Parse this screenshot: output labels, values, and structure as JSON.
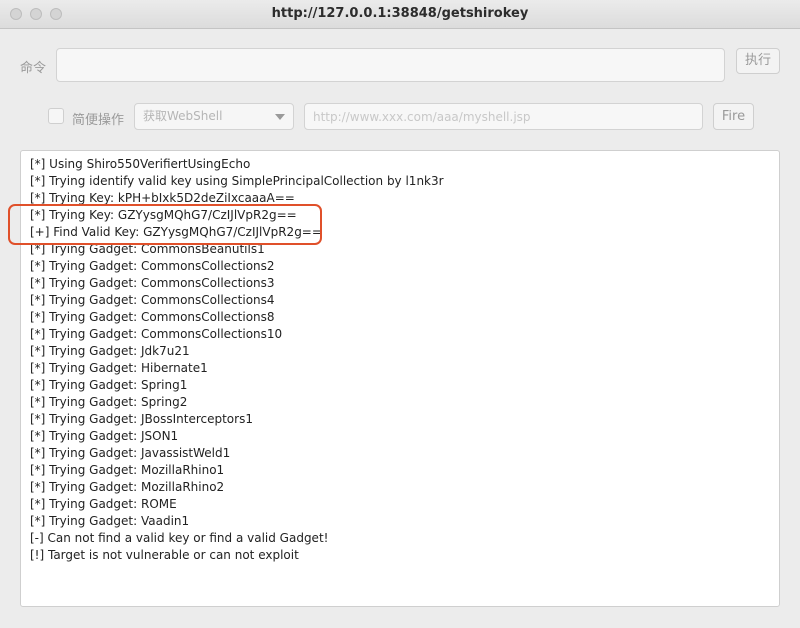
{
  "window": {
    "title": "http://127.0.0.1:38848/getshirokey"
  },
  "command": {
    "label": "命令",
    "value": "",
    "execute_label": "执行"
  },
  "shortcut": {
    "checkbox_label": "简便操作",
    "checked": false,
    "select_value": "获取WebShell",
    "url_placeholder": "http://www.xxx.com/aaa/myshell.jsp",
    "fire_label": "Fire"
  },
  "output": {
    "lines": [
      "[*] Using Shiro550VerifiertUsingEcho",
      "[*] Trying identify valid key using SimplePrincipalCollection by l1nk3r",
      "[*] Trying Key: kPH+bIxk5D2deZiIxcaaaA==",
      "[*] Trying Key: GZYysgMQhG7/CzIJlVpR2g==",
      "[+] Find Valid Key: GZYysgMQhG7/CzIJlVpR2g==",
      "[*] Trying Gadget: CommonsBeanutils1",
      "[*] Trying Gadget: CommonsCollections2",
      "[*] Trying Gadget: CommonsCollections3",
      "[*] Trying Gadget: CommonsCollections4",
      "[*] Trying Gadget: CommonsCollections8",
      "[*] Trying Gadget: CommonsCollections10",
      "[*] Trying Gadget: Jdk7u21",
      "[*] Trying Gadget: Hibernate1",
      "[*] Trying Gadget: Spring1",
      "[*] Trying Gadget: Spring2",
      "[*] Trying Gadget: JBossInterceptors1",
      "[*] Trying Gadget: JSON1",
      "[*] Trying Gadget: JavassistWeld1",
      "[*] Trying Gadget: MozillaRhino1",
      "[*] Trying Gadget: MozillaRhino2",
      "[*] Trying Gadget: ROME",
      "[*] Trying Gadget: Vaadin1",
      "[-] Can not find a valid key or find a valid Gadget!",
      "[!] Target is not vulnerable or can not exploit"
    ]
  },
  "colors": {
    "highlight": "#e0502a"
  }
}
